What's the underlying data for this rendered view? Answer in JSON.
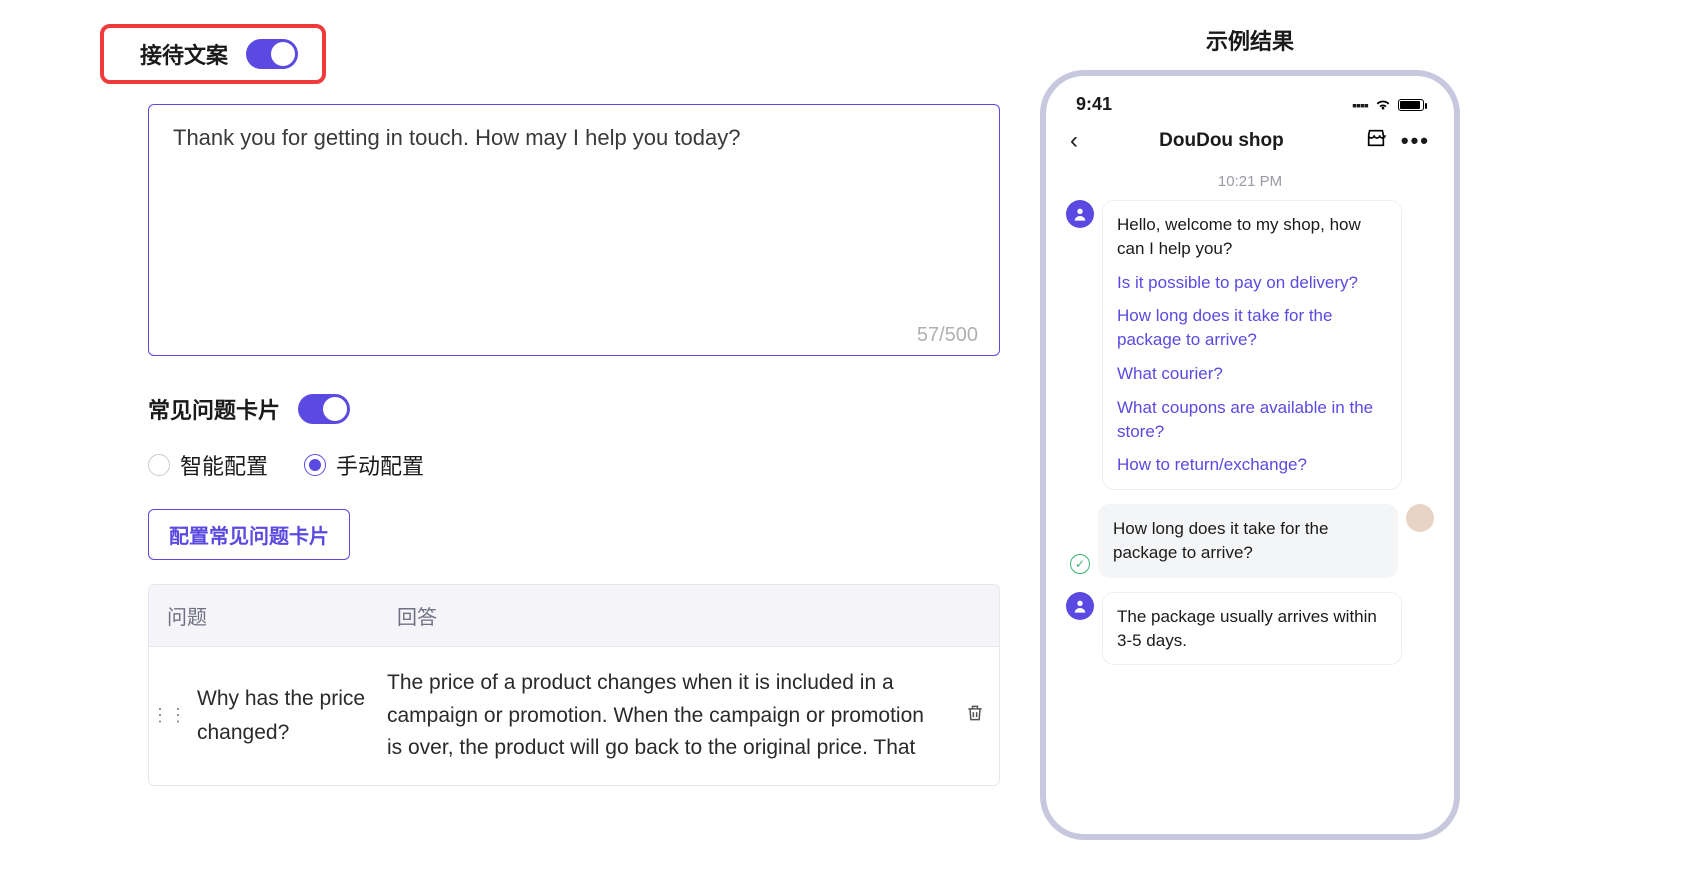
{
  "greeting": {
    "section_label": "接待文案",
    "toggle_on": true,
    "text": "Thank you for getting in touch. How may I help you today?",
    "char_count": "57/500"
  },
  "faq_card": {
    "section_label": "常见问题卡片",
    "toggle_on": true,
    "radio": {
      "smart": "智能配置",
      "manual": "手动配置",
      "selected": "manual"
    },
    "config_button": "配置常见问题卡片",
    "table": {
      "header_question": "问题",
      "header_answer": "回答",
      "rows": [
        {
          "question": "Why has the price changed?",
          "answer": "The price of a product changes when it is included in a campaign or promotion. When the campaign or promotion is over, the product will go back to the original price. That"
        }
      ]
    }
  },
  "preview": {
    "title": "示例结果",
    "status_time": "9:41",
    "shop_name": "DouDou shop",
    "chat_time": "10:21 PM",
    "welcome_msg": "Hello, welcome to my shop, how can I help you?",
    "faq_links": [
      "Is it possible to pay on delivery?",
      "How long does it take for the package to arrive?",
      "What courier?",
      "What coupons are available in the store?",
      "How to return/exchange?"
    ],
    "user_msg": "How long does it take for the package to arrive?",
    "bot_reply": "The package usually arrives within 3-5 days."
  }
}
